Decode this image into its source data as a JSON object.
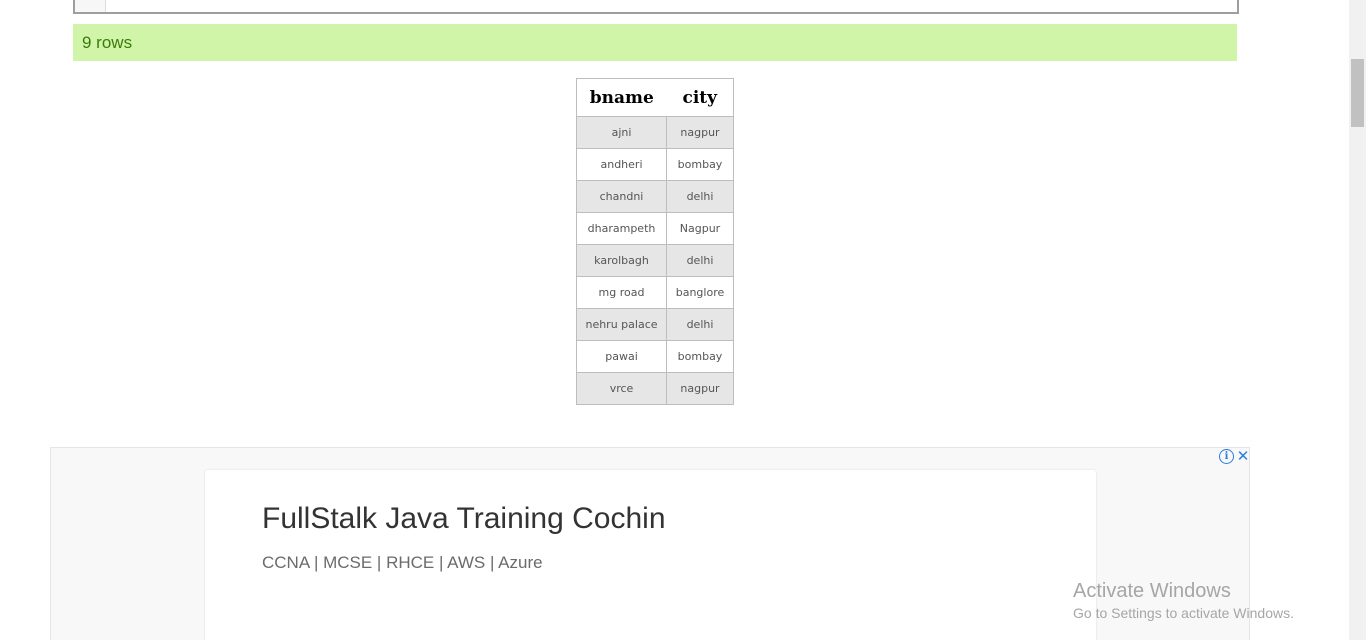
{
  "result": {
    "row_count_text": "9 rows",
    "columns": [
      "bname",
      "city"
    ],
    "rows": [
      [
        "ajni",
        "nagpur"
      ],
      [
        "andheri",
        "bombay"
      ],
      [
        "chandni",
        "delhi"
      ],
      [
        "dharampeth",
        "Nagpur"
      ],
      [
        "karolbagh",
        "delhi"
      ],
      [
        "mg road",
        "banglore"
      ],
      [
        "nehru palace",
        "delhi"
      ],
      [
        "pawai",
        "bombay"
      ],
      [
        "vrce",
        "nagpur"
      ]
    ]
  },
  "ad": {
    "title": "FullStalk Java Training Cochin",
    "subtitle": "CCNA | MCSE | RHCE | AWS | Azure",
    "info_icon": "info-icon",
    "close_icon": "close-icon",
    "info_glyph": "i",
    "close_glyph": "✕"
  },
  "watermark": {
    "title": "Activate Windows",
    "subtitle": "Go to Settings to activate Windows."
  },
  "colors": {
    "result_bar_bg": "#d1f5a8",
    "result_bar_text": "#3b7a0f",
    "ad_icon": "#2a7de1"
  }
}
